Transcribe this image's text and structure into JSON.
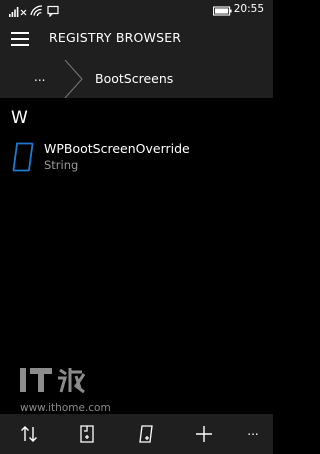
{
  "status_bar": {
    "time": "20:55",
    "icons": [
      "signal-icon",
      "no-sim-icon",
      "wifi-icon",
      "message-icon",
      "battery-icon"
    ]
  },
  "header": {
    "title": "REGISTRY BROWSER",
    "menu_icon": "hamburger-icon"
  },
  "breadcrumb": {
    "parent_label": "...",
    "current": "BootScreens"
  },
  "content": {
    "group_letter": "W",
    "entries": [
      {
        "name": "WPBootScreenOverride",
        "type": "String",
        "icon": "string-value-icon"
      }
    ]
  },
  "watermark": {
    "logo": "ithome-logo",
    "url": "www.ithome.com"
  },
  "app_bar": {
    "buttons": [
      {
        "name": "sort-icon"
      },
      {
        "name": "new-key-icon"
      },
      {
        "name": "new-value-icon"
      },
      {
        "name": "add-icon"
      }
    ],
    "more_label": "..."
  },
  "colors": {
    "background": "#000000",
    "bar_background": "#1f1f1f",
    "accent": "#1e7ad0",
    "secondary_text": "#9a9a9a"
  }
}
